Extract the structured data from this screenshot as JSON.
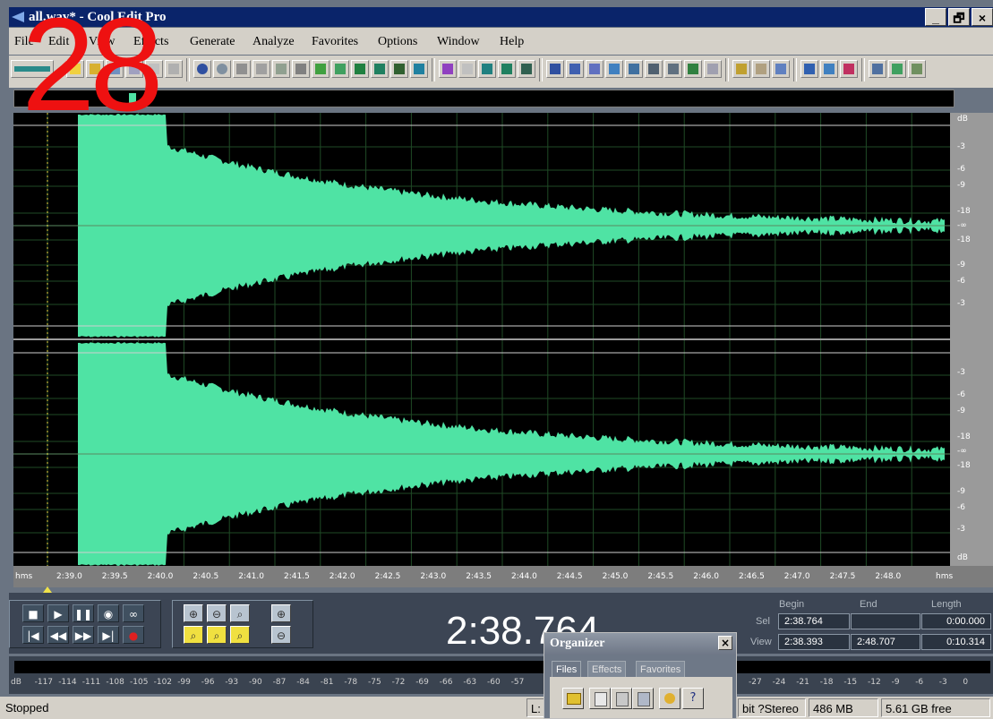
{
  "window": {
    "title": "all.wav* - Cool Edit Pro",
    "minimize": "_",
    "restore": "🗗",
    "close": "×"
  },
  "menu": [
    "File",
    "Edit",
    "View",
    "Effects",
    "Generate",
    "Analyze",
    "Favorites",
    "Options",
    "Window",
    "Help"
  ],
  "overlay_number": "28",
  "db_scale": [
    "dB",
    "-3",
    "-6",
    "-9",
    "-18",
    "-∞",
    "-18",
    "-9",
    "-6",
    "-3",
    "-3",
    "-6",
    "-9",
    "-18",
    "-∞",
    "-18",
    "-9",
    "-6",
    "-3",
    "dB"
  ],
  "time_ruler": {
    "unit_left": "hms",
    "unit_right": "hms",
    "ticks": [
      "2:39.0",
      "2:39.5",
      "2:40.0",
      "2:40.5",
      "2:41.0",
      "2:41.5",
      "2:42.0",
      "2:42.5",
      "2:43.0",
      "2:43.5",
      "2:44.0",
      "2:44.5",
      "2:45.0",
      "2:45.5",
      "2:46.0",
      "2:46.5",
      "2:47.0",
      "2:47.5",
      "2:48.0"
    ]
  },
  "transport": {
    "time_display": "2:38.764"
  },
  "selection": {
    "headers": {
      "begin": "Begin",
      "end": "End",
      "length": "Length"
    },
    "sel": {
      "label": "Sel",
      "begin": "2:38.764",
      "end": "",
      "length": "0:00.000"
    },
    "view": {
      "label": "View",
      "begin": "2:38.393",
      "end": "2:48.707",
      "length": "0:10.314"
    }
  },
  "level_meter": [
    "dB",
    "-117",
    "-114",
    "-111",
    "-108",
    "-105",
    "-102",
    "-99",
    "-96",
    "-93",
    "-90",
    "-87",
    "-84",
    "-81",
    "-78",
    "-75",
    "-72",
    "-69",
    "-66",
    "-63",
    "-60",
    "-57",
    "-27",
    "-24",
    "-21",
    "-18",
    "-15",
    "-12",
    "-9",
    "-6",
    "-3",
    "0"
  ],
  "organizer": {
    "title": "Organizer",
    "close": "×",
    "tabs": [
      "Files",
      "Effects",
      "Favorites"
    ],
    "help": "?"
  },
  "status": {
    "state": "Stopped",
    "left_partial": "L: (",
    "format": "bit ?Stereo",
    "size": "486 MB",
    "free": "5.61 GB free"
  },
  "colors": {
    "waveform": "#4fe3a4",
    "background": "#000000",
    "title_bar": "#0a246a",
    "overlay": "#ee1111"
  }
}
